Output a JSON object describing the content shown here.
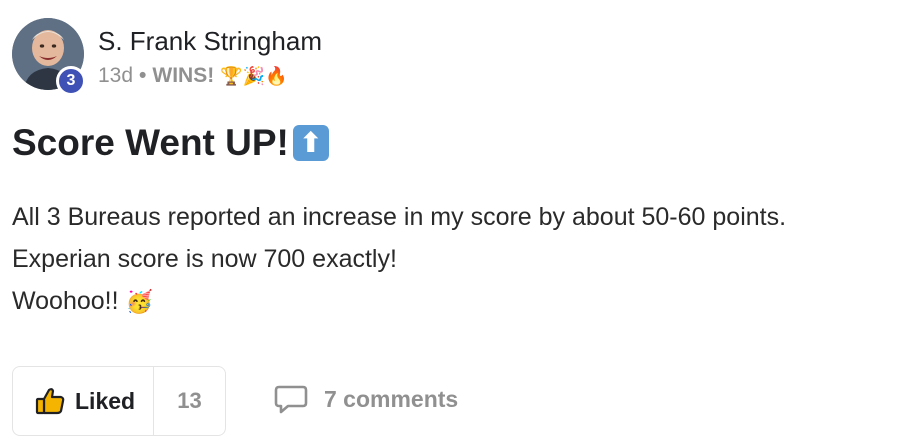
{
  "post": {
    "author": {
      "name": "S. Frank Stringham",
      "level": "3"
    },
    "time": "13d",
    "separator": "•",
    "category": "WINS!",
    "category_emoji": "🏆🎉🔥",
    "title": "Score Went UP!",
    "title_emoji": "⬆",
    "body_lines": [
      "All 3 Bureaus reported an increase in my score by about 50-60 points.",
      "Experian score is now 700 exactly!",
      "Woohoo!!"
    ],
    "body_emoji": "🥳"
  },
  "actions": {
    "like_label": "Liked",
    "like_count": "13",
    "comments_label": "7 comments"
  },
  "colors": {
    "level_badge": "#3f51b5",
    "muted_text": "#909090",
    "up_arrow_box": "#5b9bd5"
  }
}
